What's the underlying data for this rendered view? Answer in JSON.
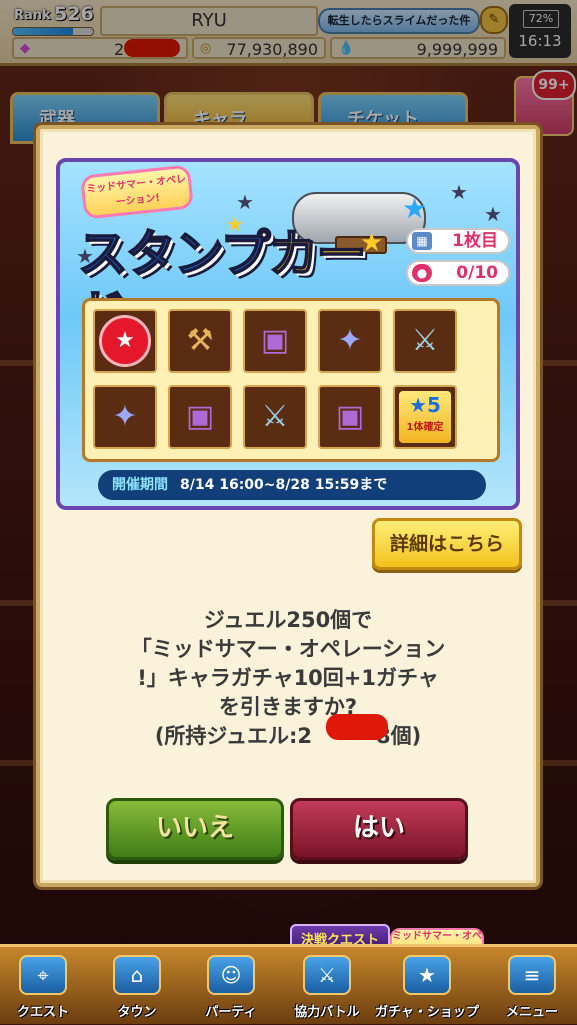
{
  "header": {
    "rank_label": "Rank",
    "rank_value": "526",
    "rank_progress": 0.75,
    "player_name": "RYU",
    "event_badge": "転生したらスライムだった件",
    "gem_count_prefix": "2",
    "coins": "77,930,890",
    "stamina": "9,999,999"
  },
  "status_bar": {
    "battery": "72%",
    "time": "16:13"
  },
  "background_tabs": [
    "武器",
    "キャラ",
    "チケット"
  ],
  "gift_badge": "99+",
  "banner": {
    "event_logo": "ミッドサマー・オペレーション!",
    "title_part1": "スタンプ",
    "title_part2": "カード",
    "sheet_count": "1枚目",
    "stamp_progress": "0/10",
    "reward_label": "1体確定",
    "reward_stars": "★5",
    "period_label": "開催期間",
    "period_value": "8/14 16:00~8/28 15:59まで"
  },
  "detail_button": "詳細はこちら",
  "message": {
    "line1": "ジュエル250個で",
    "line2": "「ミッドサマー・オペレーション",
    "line3": "!」キャラガチャ10回+1ガチャ",
    "line4": "を引きますか?",
    "line5": "(所持ジュエル:2",
    "line5_suffix": "8個)"
  },
  "buttons": {
    "no": "いいえ",
    "yes": "はい"
  },
  "bottom_nav": {
    "items": [
      "クエスト",
      "タウン",
      "パーティ",
      "協力バトル",
      "ガチャ・ショップ",
      "メニュー"
    ],
    "quest_banner": "決戦クエスト",
    "event_mini": "ミッドサマー・オペレーション!"
  },
  "colors": {
    "dialog_bg": "#fbf2dc",
    "no_button": "#3f7d16",
    "yes_button": "#7a1428",
    "title_blue": "#1e6fe0",
    "title_yellow": "#ffc81e",
    "accent_pink": "#e0306a"
  }
}
